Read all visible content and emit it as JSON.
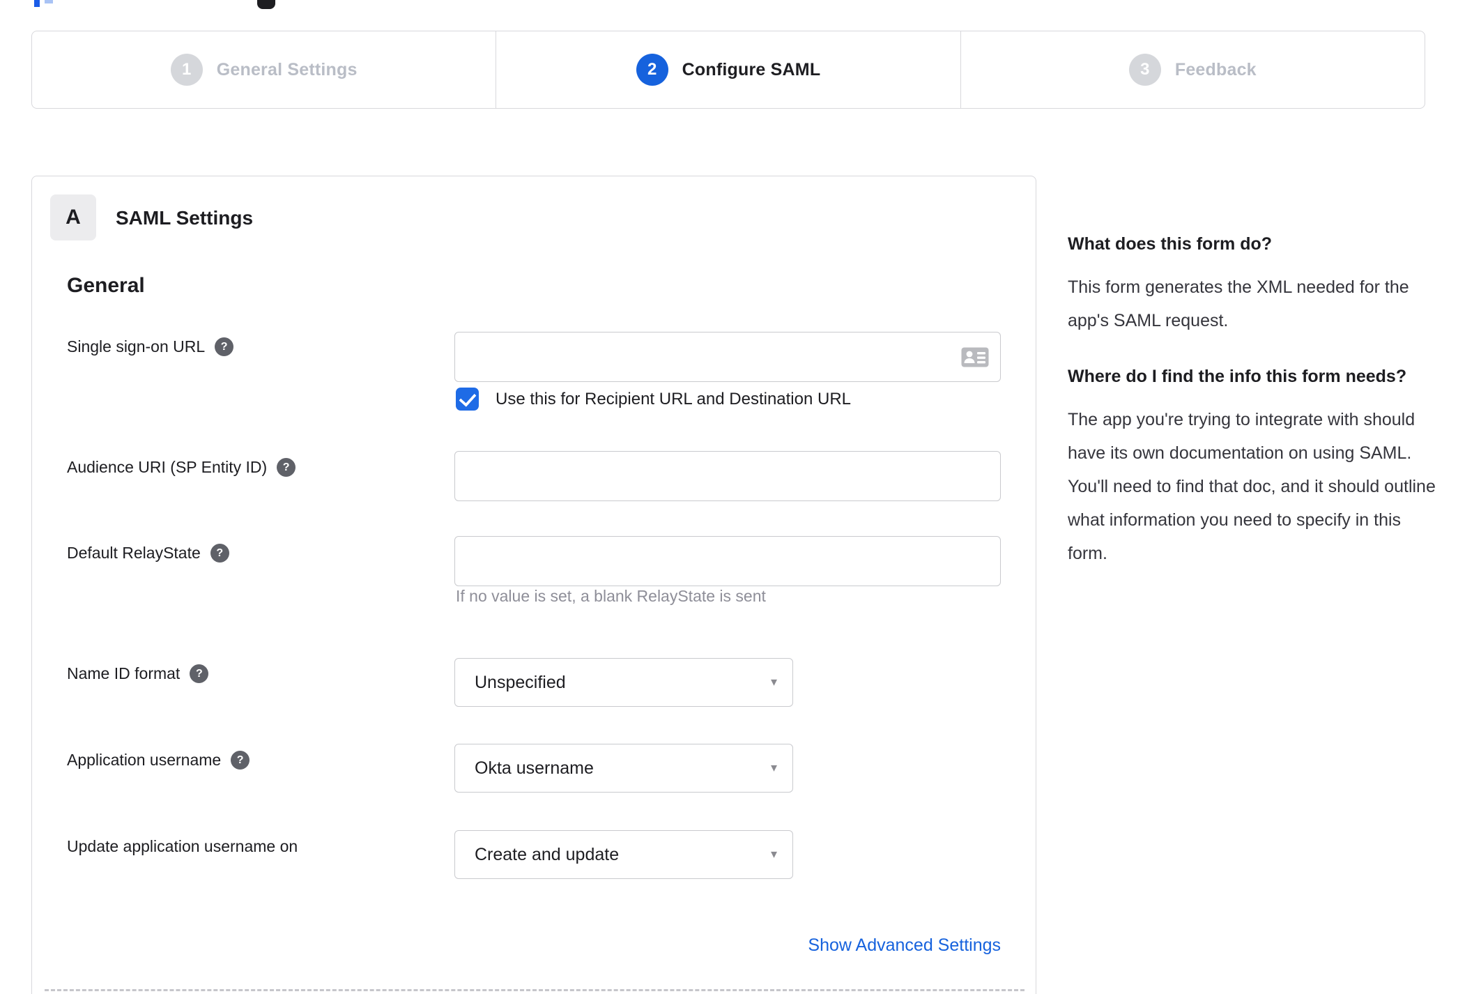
{
  "stepper": {
    "steps": [
      {
        "number": "1",
        "label": "General Settings",
        "active": false
      },
      {
        "number": "2",
        "label": "Configure SAML",
        "active": true
      },
      {
        "number": "3",
        "label": "Feedback",
        "active": false
      }
    ]
  },
  "card": {
    "badge": "A",
    "title": "SAML Settings",
    "section_heading": "General"
  },
  "fields": {
    "sso": {
      "label": "Single sign-on URL",
      "value": "",
      "checkbox_label": "Use this for Recipient URL and Destination URL",
      "checkbox_checked": true
    },
    "audience": {
      "label": "Audience URI (SP Entity ID)",
      "value": ""
    },
    "relaystate": {
      "label": "Default RelayState",
      "value": "",
      "helper": "If no value is set, a blank RelayState is sent"
    },
    "nameid": {
      "label": "Name ID format",
      "value": "Unspecified"
    },
    "appusername": {
      "label": "Application username",
      "value": "Okta username"
    },
    "updateusername": {
      "label": "Update application username on",
      "value": "Create and update"
    }
  },
  "links": {
    "advanced": "Show Advanced Settings"
  },
  "sidebar": {
    "q1": "What does this form do?",
    "a1": "This form generates the XML needed for the app's SAML request.",
    "q2": "Where do I find the info this form needs?",
    "a2": "The app you're trying to integrate with should have its own documentation on using SAML. You'll need to find that doc, and it should outline what information you need to specify in this form."
  },
  "glyphs": {
    "help": "?",
    "dropdown": "▾"
  },
  "colors": {
    "accent_blue": "#1662dd",
    "checkbox_blue": "#1e6be6",
    "inactive_gray": "#b9bdc6",
    "circle_gray": "#d5d7db",
    "border_gray": "#d8d8dc",
    "helper_gray": "#8e8e98",
    "help_icon_gray": "#5f6168"
  }
}
